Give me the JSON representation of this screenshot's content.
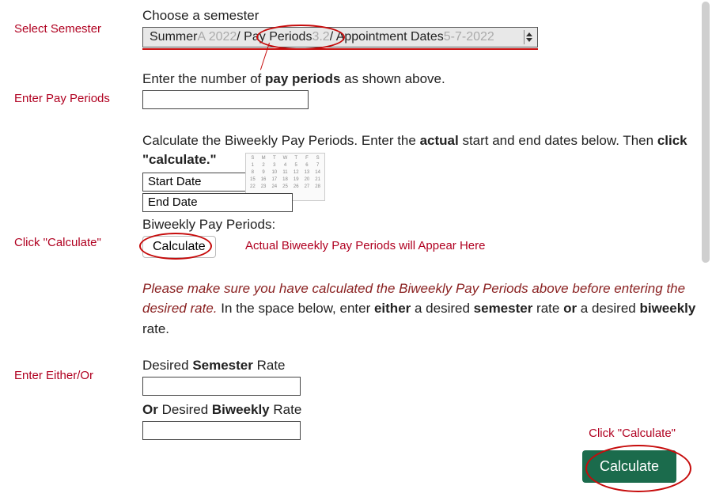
{
  "margin": {
    "select_semester": "Select Semester",
    "enter_pay_periods": "Enter Pay Periods",
    "click_calculate": "Click \"Calculate\"",
    "enter_either_or": "Enter  Either/Or"
  },
  "form": {
    "choose_semester_label": "Choose a semester",
    "semester_value": {
      "p1": "Summer ",
      "p2_faded": "A 2022",
      "p3": " / Pay Periods ",
      "p4_faded": "3.2",
      "p5": " / Appointment Dates ",
      "p6_faded": "5-7-2022"
    },
    "enter_pay_periods_label_pre": "Enter the number of ",
    "enter_pay_periods_label_bold": "pay periods",
    "enter_pay_periods_label_post": " as shown above.",
    "biweekly_instr_pre": "Calculate the Biweekly Pay Periods. Enter the ",
    "biweekly_instr_b1": "actual",
    "biweekly_instr_mid": " start and end dates below. Then ",
    "biweekly_instr_b2": "click \"calculate.\"",
    "start_date_placeholder": "Start Date",
    "end_date_placeholder": "End Date",
    "biweekly_result_label": "Biweekly Pay Periods:",
    "calc_small": "Calculate",
    "appear_note": "Actual Biweekly Pay Periods will Appear Here",
    "warn_italic": "Please make sure you have calculated the Biweekly Pay Periods above before entering the desired rate.",
    "warn_plain_1": " In the space below, enter ",
    "warn_b1": "either",
    "warn_plain_2": " a desired ",
    "warn_b2": "semester",
    "warn_plain_3": " rate ",
    "warn_b3": "or",
    "warn_plain_4": " a desired ",
    "warn_b4": "biweekly",
    "warn_plain_5": " rate.",
    "desired_semester_pre": "Desired ",
    "desired_semester_b": "Semester",
    "desired_semester_post": " Rate",
    "or_biweekly_b1": "Or",
    "or_biweekly_mid": " Desired ",
    "or_biweekly_b2": "Biweekly",
    "or_biweekly_post": " Rate",
    "calc_big": "Calculate"
  },
  "annotations": {
    "click_calculate2": "Click \"Calculate\""
  }
}
